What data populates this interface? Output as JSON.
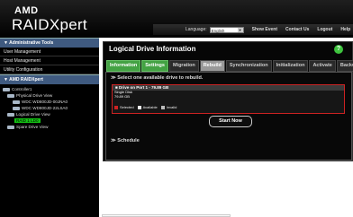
{
  "brand": {
    "amd": "AMD",
    "name": "RAIDXpert"
  },
  "topbar": {
    "language_label": "Language:",
    "language_value": "English",
    "links": [
      "Show Event",
      "Contact Us",
      "Logout",
      "Help"
    ]
  },
  "left": {
    "admin_header": "Administrative Tools",
    "admin_items": [
      "User Management",
      "Host Management",
      "Utility Configuration"
    ],
    "raid_header": "AMD RAIDXpert",
    "tree": {
      "controller": "Controller1",
      "physical": "Physical Drive View",
      "drive1": "WDC WD800JD-00JNA0",
      "drive2": "WDC WD800JD-22LSA0",
      "logical": "Logical Drive View",
      "ld": "RAID 1 LD0",
      "spare": "Spare Drive View"
    }
  },
  "main": {
    "title": "Logical Drive Information",
    "tabs": [
      "Information",
      "Settings",
      "Migration",
      "Rebuild",
      "Synchronization",
      "Initialization",
      "Activate",
      "Backup"
    ],
    "subtitle": "Select one available drive to rebuild.",
    "drive": {
      "header": "Drive on Port 1 - 79.89 GB",
      "type": "Single Disk",
      "size": "79.89 GB"
    },
    "legend": [
      "Selected",
      "Available",
      "Invalid"
    ],
    "start_label": "Start Now",
    "schedule_label": "Schedule"
  },
  "colors": {
    "selected": "#cc2222",
    "available": "#eeeeee",
    "invalid": "#bbbbbb",
    "tab_green": "#43a243"
  }
}
